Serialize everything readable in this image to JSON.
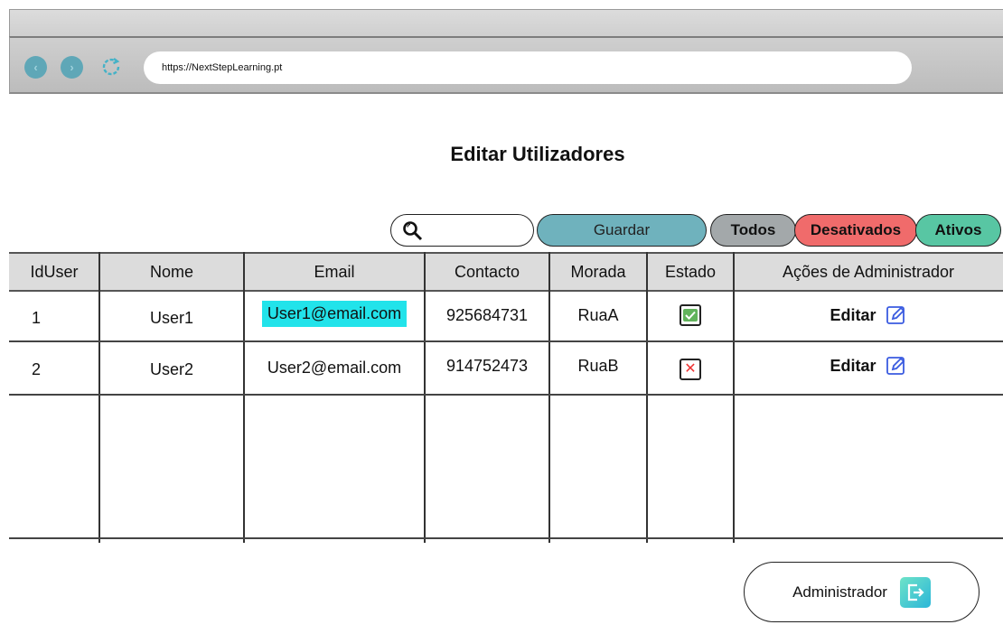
{
  "browser": {
    "url": "https://NextStepLearning.pt",
    "back_glyph": "‹",
    "forward_glyph": "›"
  },
  "page": {
    "title": "Editar Utilizadores"
  },
  "toolbar": {
    "search_placeholder": "",
    "save_label": "Guardar",
    "filters": {
      "all": "Todos",
      "disabled": "Desativados",
      "active": "Ativos"
    }
  },
  "table": {
    "columns": [
      "IdUser",
      "Nome",
      "Email",
      "Contacto",
      "Morada",
      "Estado",
      "Ações de Administrador"
    ],
    "rows": [
      {
        "id": "1",
        "name": "User1",
        "email": "User1@email.com",
        "contact": "925684731",
        "address": "RuaA",
        "status": "active",
        "action": "Editar"
      },
      {
        "id": "2",
        "name": "User2",
        "email": "User2@email.com",
        "contact": "914752473",
        "address": "RuaB",
        "status": "disabled",
        "action": "Editar"
      }
    ]
  },
  "footer": {
    "admin_label": "Administrador"
  },
  "colors": {
    "accent_teal": "#6fb2bd",
    "filter_all": "#a3a8aa",
    "filter_disabled": "#f06b6b",
    "filter_active": "#58c6a3",
    "highlight": "#22e3ea",
    "edit_icon": "#3a5be0"
  },
  "icons": {
    "back": "arrow-left-icon",
    "forward": "arrow-right-icon",
    "reload": "reload-icon",
    "search": "search-icon",
    "edit": "pencil-icon",
    "exit": "exit-icon"
  }
}
